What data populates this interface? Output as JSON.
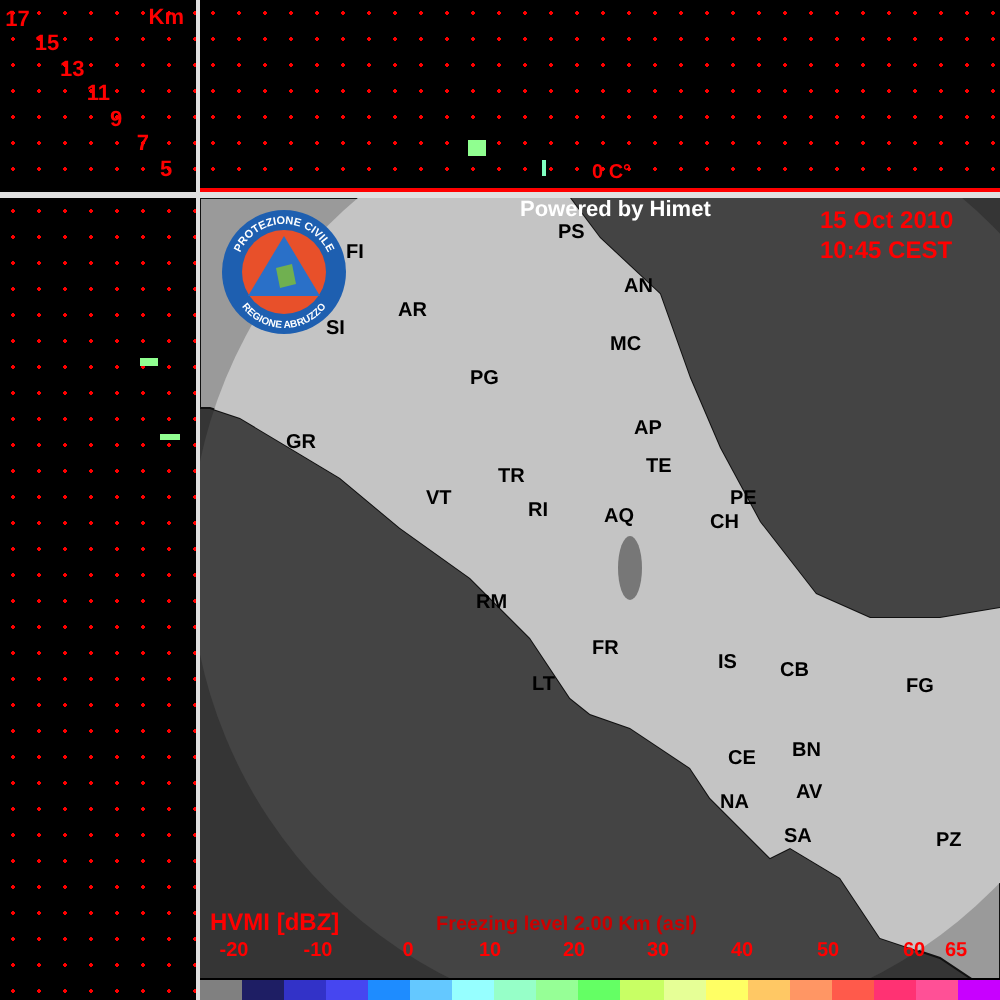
{
  "height_axis": {
    "unit": "Km",
    "ticks": [
      "17",
      "15",
      "13",
      "11",
      "9",
      "7",
      "5"
    ]
  },
  "section_panel": {
    "freezing_marker": "0 C°"
  },
  "map": {
    "logo": {
      "top_text": "PROTEZIONE CIVILE",
      "bottom_text": "REGIONE ABRUZZO"
    },
    "credit": "Powered by Himet",
    "date": "15 Oct 2010",
    "time": "10:45 CEST",
    "cities": [
      "FI",
      "PS",
      "AN",
      "SI",
      "AR",
      "MC",
      "PG",
      "GR",
      "AP",
      "TE",
      "TR",
      "VT",
      "RI",
      "AQ",
      "PE",
      "CH",
      "RM",
      "FR",
      "IS",
      "CB",
      "FG",
      "LT",
      "CE",
      "BN",
      "AV",
      "NA",
      "SA",
      "PZ"
    ],
    "product": "HVMI [dBZ]",
    "freezing_level": "Freezing level  2.00 Km (asl)"
  },
  "legend": {
    "labels": [
      "-20",
      "-10",
      "0",
      "10",
      "20",
      "30",
      "40",
      "50",
      "60",
      "65"
    ],
    "swatches": [
      {
        "color": "#808080"
      },
      {
        "color": "#1e1e64"
      },
      {
        "color": "#3232c8"
      },
      {
        "color": "#4646f0"
      },
      {
        "color": "#1e8cff"
      },
      {
        "color": "#64c8ff"
      },
      {
        "color": "#96ffff"
      },
      {
        "color": "#96ffc8"
      },
      {
        "color": "#96ff96"
      },
      {
        "color": "#64ff64"
      },
      {
        "color": "#c8ff64"
      },
      {
        "color": "#e6ff96"
      },
      {
        "color": "#ffff64"
      },
      {
        "color": "#ffc864"
      },
      {
        "color": "#ff9664"
      },
      {
        "color": "#ff5a4b"
      },
      {
        "color": "#ff3273"
      },
      {
        "color": "#ff5096"
      },
      {
        "color": "#c800ff"
      }
    ]
  }
}
